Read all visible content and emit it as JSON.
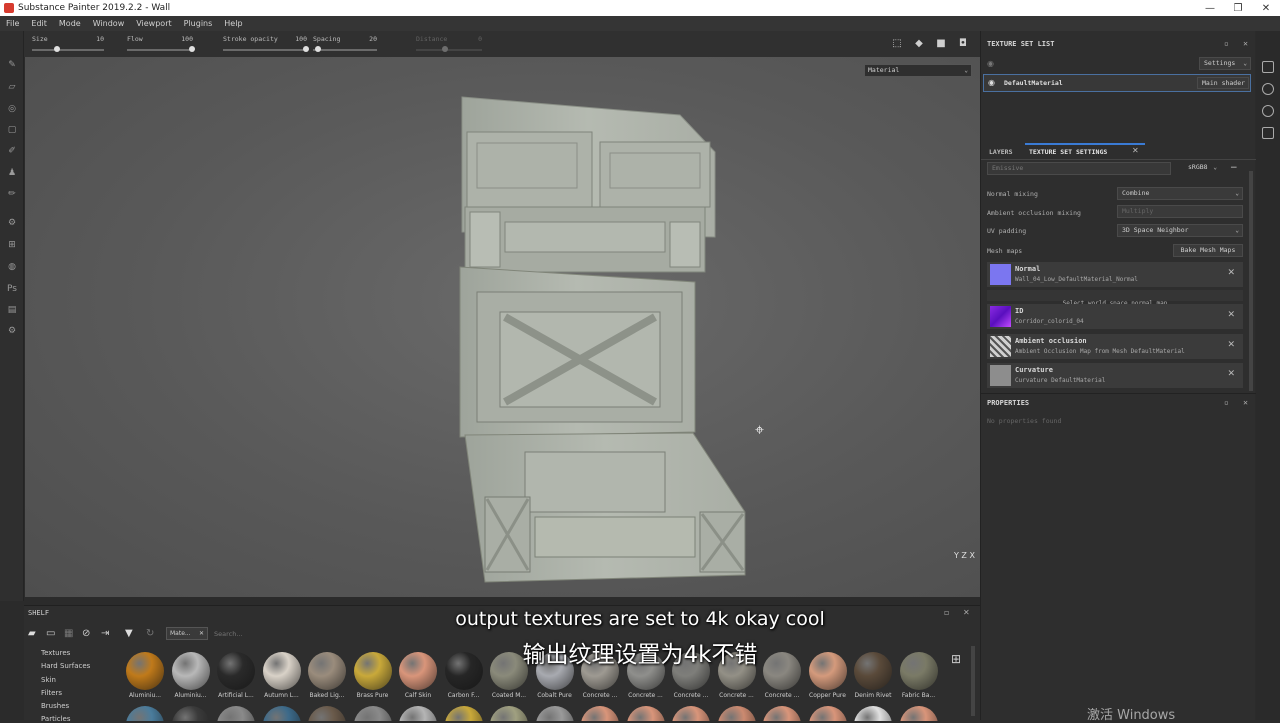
{
  "window": {
    "title": "Substance Painter 2019.2.2 - Wall",
    "controls": [
      "—",
      "❐",
      "✕"
    ]
  },
  "menu": [
    "File",
    "Edit",
    "Mode",
    "Window",
    "Viewport",
    "Plugins",
    "Help"
  ],
  "toolbar": {
    "size": {
      "label": "Size",
      "value": "10"
    },
    "flow": {
      "label": "Flow",
      "value": "100"
    },
    "stroke_opacity": {
      "label": "Stroke opacity",
      "value": "100"
    },
    "spacing": {
      "label": "Spacing",
      "value": "20"
    },
    "distance": {
      "label": "Distance",
      "value": "0"
    }
  },
  "viewport": {
    "mode_select": "Material",
    "axis_label": "Y Z X"
  },
  "texture_set_list": {
    "title": "TEXTURE SET LIST",
    "settings_label": "Settings",
    "item_name": "DefaultMaterial",
    "shader_label": "Main shader"
  },
  "tabs": {
    "layers": "LAYERS",
    "texture_set_settings": "TEXTURE SET SETTINGS"
  },
  "texture_set_settings": {
    "channel_field": "Emissive",
    "channel_format": "sRGB8",
    "normal_mixing_label": "Normal mixing",
    "normal_mixing_value": "Combine",
    "ao_mixing_label": "Ambient occlusion mixing",
    "ao_mixing_value": "Multiply",
    "uv_padding_label": "UV padding",
    "uv_padding_value": "3D Space Neighbor",
    "mesh_maps_label": "Mesh maps",
    "bake_button": "Bake Mesh Maps",
    "select_world_normal": "Select world space normal map",
    "maps": [
      {
        "name": "Normal",
        "file": "Wall_04_Low_DefaultMaterial_Normal",
        "thumb_color": "#7b76f0"
      },
      {
        "name": "ID",
        "file": "Corridor_colorid_04",
        "thumb_color": "#8a2be2"
      },
      {
        "name": "Ambient occlusion",
        "file": "Ambient Occlusion Map from Mesh DefaultMaterial",
        "thumb_color": "#c8c8c8"
      },
      {
        "name": "Curvature",
        "file": "Curvature DefaultMaterial",
        "thumb_color": "#8d8d8d"
      }
    ]
  },
  "properties": {
    "title": "PROPERTIES",
    "empty_text": "No properties found"
  },
  "shelf": {
    "title": "SHELF",
    "filter_tag": "Mate...",
    "search_placeholder": "Search...",
    "categories": [
      "Textures",
      "Hard Surfaces",
      "Skin",
      "Filters",
      "Brushes",
      "Particles"
    ],
    "materials": [
      {
        "label": "Aluminiu...",
        "color": "#c07a1a"
      },
      {
        "label": "Aluminiu...",
        "color": "#b8b8b8"
      },
      {
        "label": "Artificial L...",
        "color": "#2a2a2a"
      },
      {
        "label": "Autumn L...",
        "color": "#d9d2c8"
      },
      {
        "label": "Baked Lig...",
        "color": "#9a8c7c"
      },
      {
        "label": "Brass Pure",
        "color": "#c9a93a"
      },
      {
        "label": "Calf Skin",
        "color": "#d9957a"
      },
      {
        "label": "Carbon F...",
        "color": "#262626"
      },
      {
        "label": "Coated M...",
        "color": "#8a8a7a"
      },
      {
        "label": "Cobalt Pure",
        "color": "#a8aab0"
      },
      {
        "label": "Concrete ...",
        "color": "#9e9a92"
      },
      {
        "label": "Concrete ...",
        "color": "#8f8f8c"
      },
      {
        "label": "Concrete ...",
        "color": "#7e7e7a"
      },
      {
        "label": "Concrete ...",
        "color": "#939086"
      },
      {
        "label": "Concrete ...",
        "color": "#8a8780"
      },
      {
        "label": "Copper Pure",
        "color": "#d49a7c"
      },
      {
        "label": "Denim Rivet",
        "color": "#5a4a3a"
      },
      {
        "label": "Fabric Ba...",
        "color": "#7a7a66"
      }
    ],
    "row2_colors": [
      "#4a7c9c",
      "#3b3b3b",
      "#8a8a8a",
      "#3c6a8a",
      "#6a5a4a",
      "#8a8a8a",
      "#b5b5b5",
      "#c9a93a",
      "#a0a080",
      "#9a9a9a",
      "#d9957a",
      "#d9957a",
      "#d9957a",
      "#cc8a70",
      "#d9957a",
      "#d9957a",
      "#e0e0e0",
      "#d9957a"
    ]
  },
  "subtitles": {
    "english": "output textures are set to 4k okay cool",
    "chinese": "输出纹理设置为4k不错"
  },
  "watermark": "激活 Windows"
}
